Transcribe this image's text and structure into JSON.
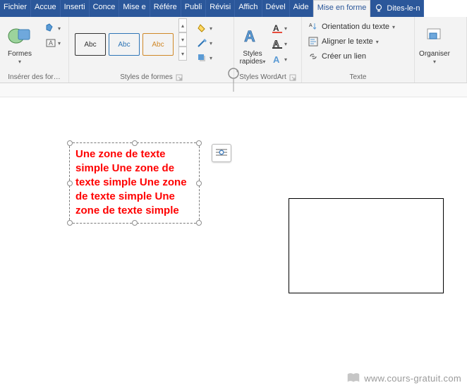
{
  "tabs": {
    "fichier": "Fichier",
    "accueil": "Accue",
    "insertion": "Inserti",
    "conception": "Conce",
    "mise_en_page": "Mise e",
    "references": "Référe",
    "publipostage": "Publi",
    "revision": "Révisi",
    "affichage": "Affich",
    "developpeur": "Dével",
    "aide": "Aide",
    "mise_en_forme": "Mise en forme",
    "tell_me": "Dites-le-n"
  },
  "ribbon": {
    "insert_shapes": {
      "label": "Insérer des for…",
      "formes": "Formes"
    },
    "shape_styles": {
      "label": "Styles de formes",
      "abc": "Abc"
    },
    "wordart": {
      "label": "Styles WordArt",
      "quick": "Styles rapides"
    },
    "text": {
      "label": "Texte",
      "orientation": "Orientation du texte",
      "align": "Aligner le texte",
      "link": "Créer un lien"
    },
    "arrange": {
      "label": "",
      "organiser": "Organiser"
    }
  },
  "canvas": {
    "textbox": "Une zone de texte simple Une zone de texte simple Une zone de texte simple Une zone de texte simple"
  },
  "ruler_label": "",
  "watermark": "www.cours-gratuit.com"
}
